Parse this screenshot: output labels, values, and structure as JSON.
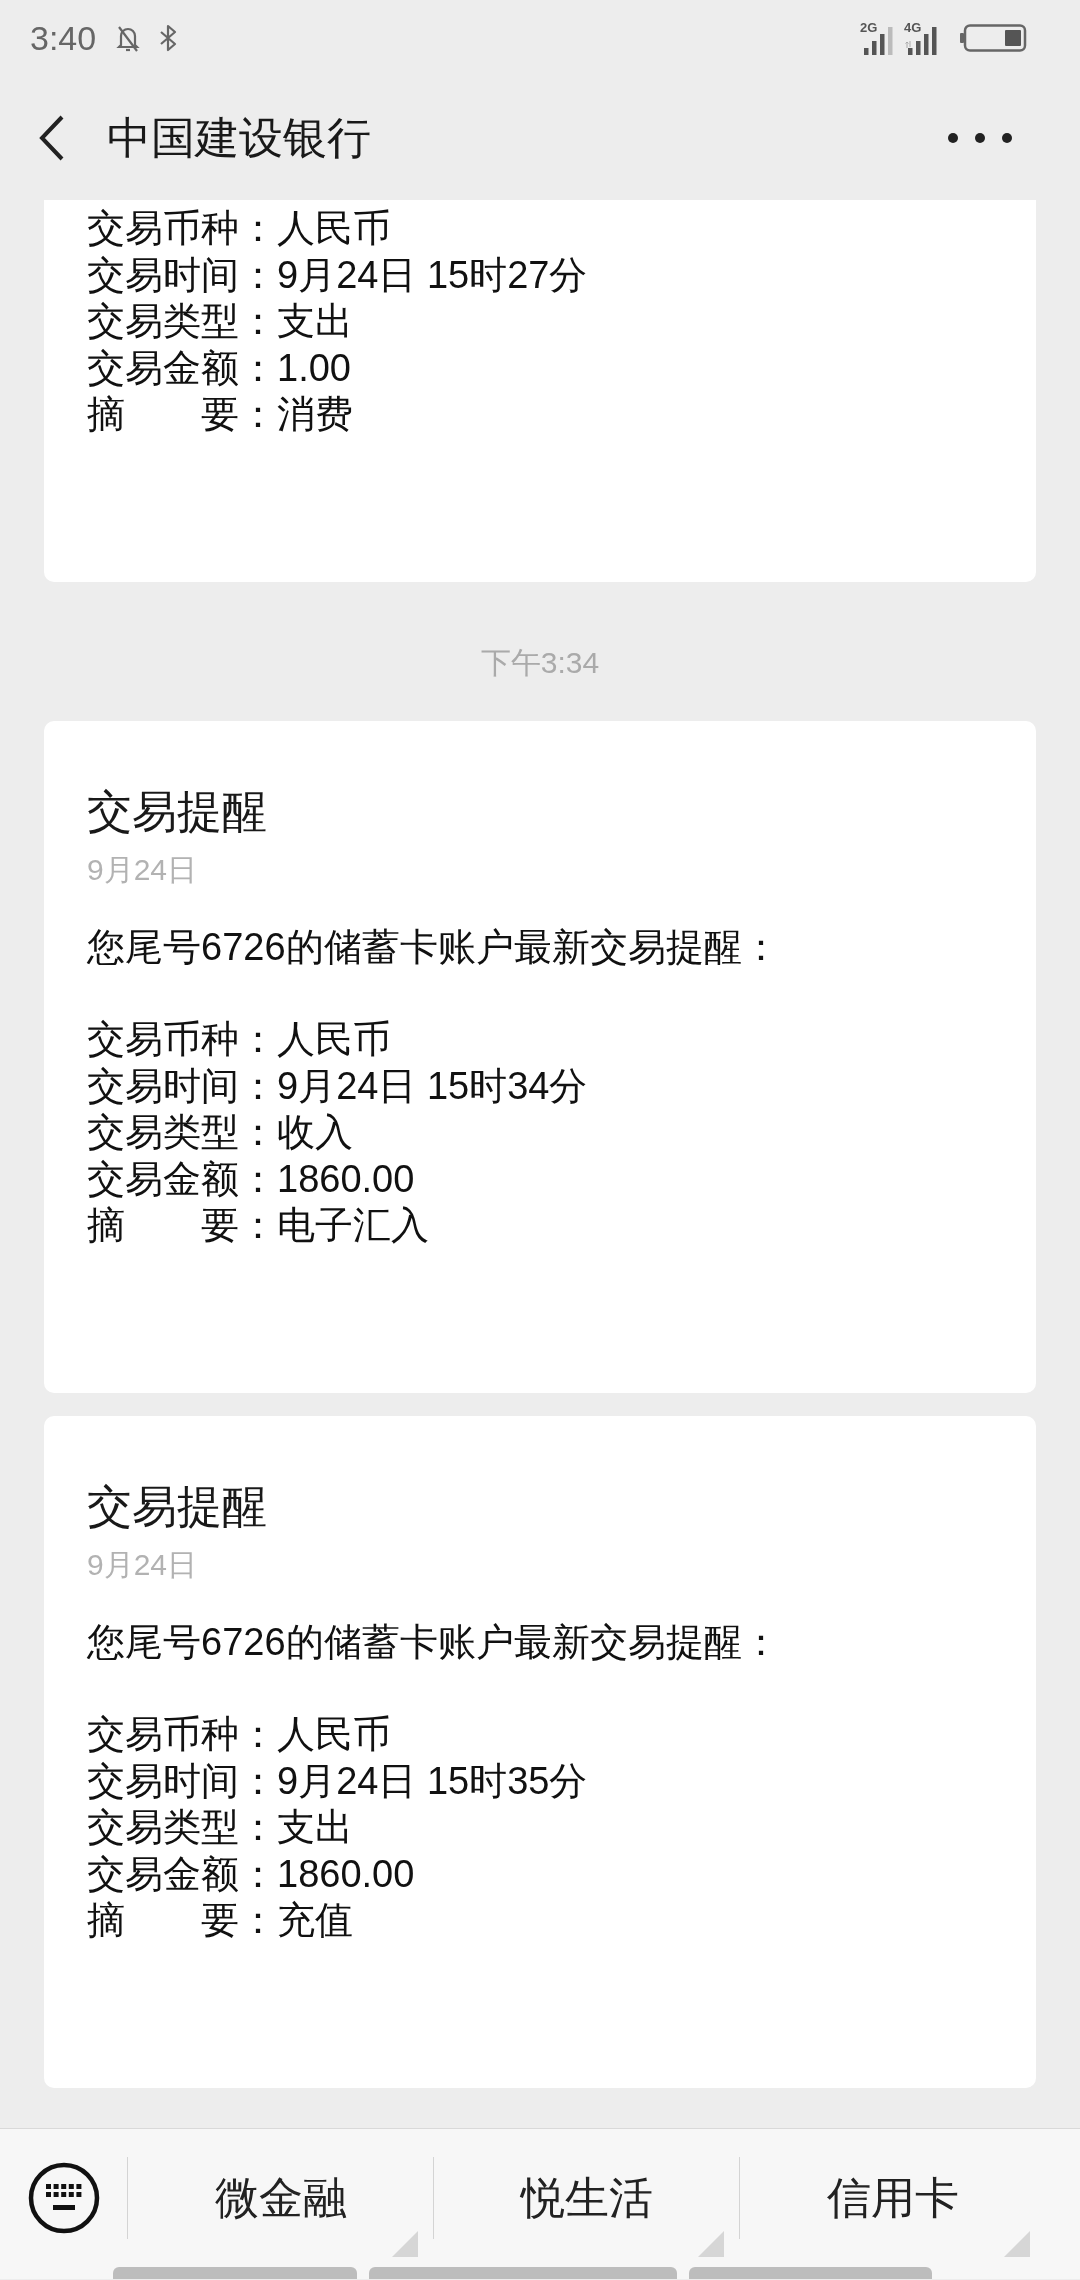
{
  "status_bar": {
    "time": "3:40",
    "networks": [
      "2G",
      "4G"
    ]
  },
  "header": {
    "title": "中国建设银行"
  },
  "messages": [
    {
      "kind": "card",
      "lines": [
        "交易币种：人民币",
        "交易时间：9月24日 15时27分",
        "交易类型：支出",
        "交易金额：1.00",
        "摘　　要：消费"
      ]
    },
    {
      "kind": "timestamp",
      "text": "下午3:34"
    },
    {
      "kind": "card",
      "title": "交易提醒",
      "date": "9月24日",
      "intro": "您尾号6726的储蓄卡账户最新交易提醒：",
      "lines": [
        "交易币种：人民币",
        "交易时间：9月24日 15时34分",
        "交易类型：收入",
        "交易金额：1860.00",
        "摘　　要：电子汇入"
      ]
    },
    {
      "kind": "card",
      "title": "交易提醒",
      "date": "9月24日",
      "intro": "您尾号6726的储蓄卡账户最新交易提醒：",
      "lines": [
        "交易币种：人民币",
        "交易时间：9月24日 15时35分",
        "交易类型：支出",
        "交易金额：1860.00",
        "摘　　要：充值"
      ]
    }
  ],
  "bottom_menu": {
    "items": [
      {
        "label": "微金融"
      },
      {
        "label": "悦生活"
      },
      {
        "label": "信用卡"
      }
    ]
  }
}
